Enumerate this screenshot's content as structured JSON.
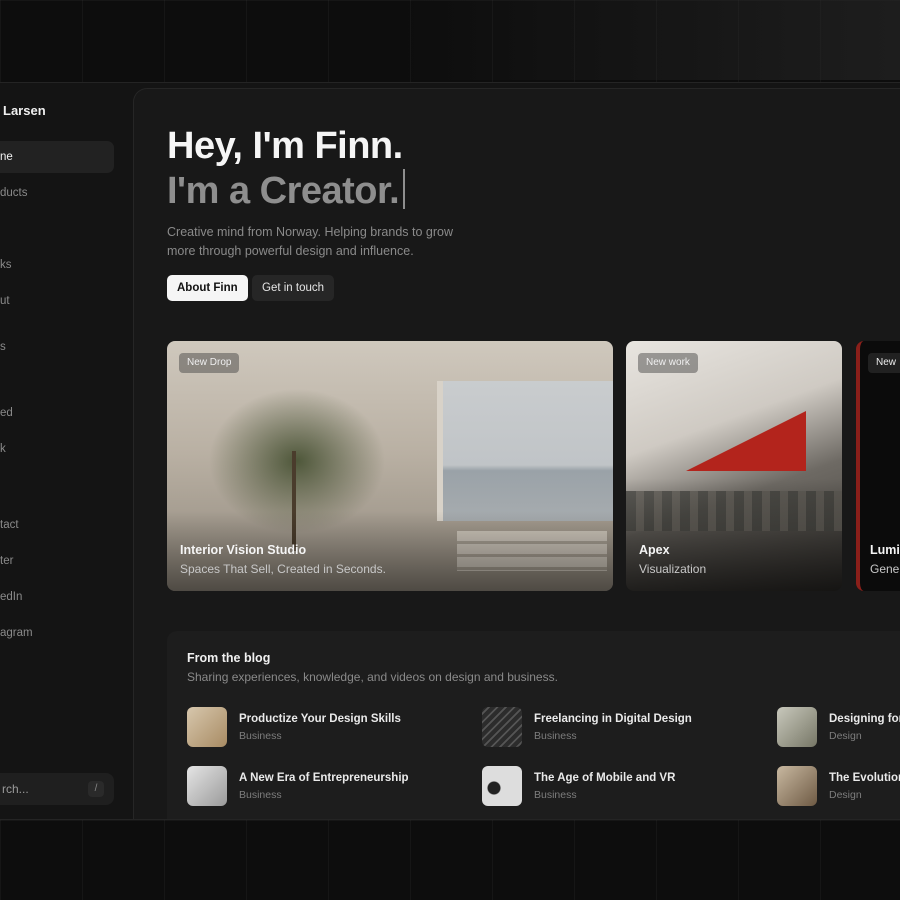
{
  "sidebar": {
    "brand": "Larsen",
    "items": [
      {
        "label": "ne",
        "active": true
      },
      {
        "label": "ducts"
      },
      {
        "label": ""
      },
      {
        "label": "ks"
      },
      {
        "label": "ut"
      },
      {
        "label": "s"
      },
      {
        "label": ""
      },
      {
        "label": "ed"
      },
      {
        "label": "k"
      },
      {
        "label": "tact"
      },
      {
        "label": "ter"
      },
      {
        "label": "edIn"
      },
      {
        "label": "agram"
      }
    ],
    "search": {
      "label": "rch...",
      "shortcut": "/"
    }
  },
  "hero": {
    "line1": "Hey, I'm Finn.",
    "line2": "I'm a Creator.",
    "intro": "Creative mind from Norway. Helping brands to grow more through powerful design and influence.",
    "primary_button": "About Finn",
    "secondary_button": "Get in touch"
  },
  "cards": [
    {
      "badge": "New Drop",
      "title": "Interior Vision Studio",
      "subtitle": "Spaces That Sell, Created in Seconds."
    },
    {
      "badge": "New work",
      "title": "Apex",
      "subtitle": "Visualization"
    },
    {
      "badge": "New",
      "title": "Lumi",
      "subtitle": "Gene"
    }
  ],
  "blog": {
    "title": "From the blog",
    "subtitle": "Sharing experiences, knowledge, and videos on design and business.",
    "posts": [
      {
        "title": "Productize Your Design Skills",
        "category": "Business"
      },
      {
        "title": "Freelancing in Digital Design",
        "category": "Business"
      },
      {
        "title": "Designing for",
        "category": "Design"
      },
      {
        "title": "A New Era of Entrepreneurship",
        "category": "Business"
      },
      {
        "title": "The Age of Mobile and VR",
        "category": "Business"
      },
      {
        "title": "The Evolution",
        "category": "Design"
      }
    ]
  }
}
